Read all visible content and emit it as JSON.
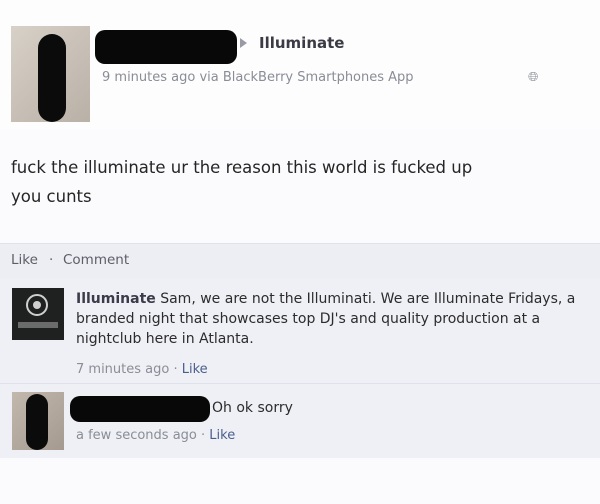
{
  "post": {
    "page_name": "Illuminate",
    "meta": "9 minutes ago via BlackBerry Smartphones App",
    "globe_icon": "globe-icon",
    "status_line1": "fuck the illuminate ur the reason this world is fucked up",
    "status_line2": "you cunts"
  },
  "actions": {
    "like": "Like",
    "separator": "·",
    "comment": "Comment"
  },
  "comments": [
    {
      "author": "Illuminate",
      "text": " Sam, we are not the Illuminati. We are Illuminate Fridays, a branded night that showcases top DJ's and quality production at a nightclub here in Atlanta.",
      "time": "7 minutes ago",
      "separator": " · ",
      "like": "Like"
    },
    {
      "text": "Oh ok sorry",
      "time": "a few seconds ago",
      "separator": " · ",
      "like": "Like"
    }
  ]
}
